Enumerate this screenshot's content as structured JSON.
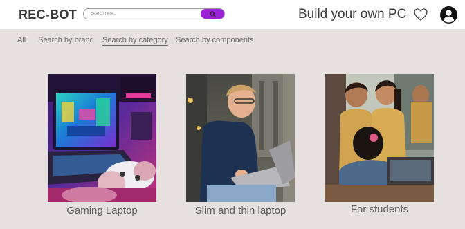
{
  "header": {
    "logo": "REC-BOT",
    "search": {
      "placeholder": "Search here..."
    },
    "title": "Build your own PC"
  },
  "icons": {
    "search": "search-icon",
    "wishlist": "heart-icon",
    "account": "user-account-icon"
  },
  "colors": {
    "accent": "#9b20d6",
    "background": "#e6e1df",
    "header_bg": "#ffffff"
  },
  "nav": {
    "items": [
      {
        "label": "All"
      },
      {
        "label": "Search by brand"
      },
      {
        "label": "Search by category",
        "active": true
      },
      {
        "label": "Search by components"
      }
    ]
  },
  "categories": [
    {
      "label": "Gaming Laptop",
      "image": "gaming-laptop-photo"
    },
    {
      "label": "Slim and thin laptop",
      "image": "slim-laptop-photo"
    },
    {
      "label": "For students",
      "image": "students-photo"
    }
  ]
}
